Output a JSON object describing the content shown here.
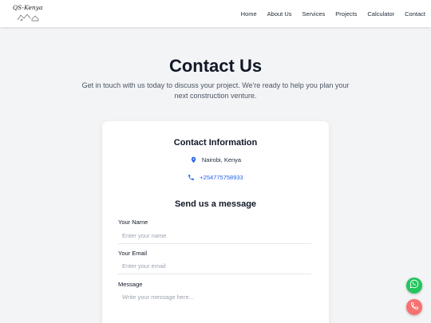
{
  "brand": {
    "logo_text": "QS-Kenya"
  },
  "nav": {
    "items": [
      "Home",
      "About Us",
      "Services",
      "Projects",
      "Calculator",
      "Contact"
    ]
  },
  "hero": {
    "title": "Contact Us",
    "subtitle": "Get in touch with us today to discuss your project. We're ready to help you plan your next construction venture."
  },
  "contact_info": {
    "heading": "Contact Information",
    "location": "Nairobi, Kenya",
    "phone": "+254775758933"
  },
  "form": {
    "heading": "Send us a message",
    "name_label": "Your Name",
    "name_placeholder": "Enter your name",
    "email_label": "Your Email",
    "email_placeholder": "Enter your email",
    "message_label": "Message",
    "message_placeholder": "Write your message here..."
  },
  "icons": {
    "location": "map-pin-icon",
    "phone": "phone-icon",
    "whatsapp": "whatsapp-icon",
    "call": "call-icon"
  },
  "colors": {
    "accent": "#2563eb",
    "whatsapp": "#22c55e",
    "call": "#f87171",
    "background": "#f3f4f6"
  }
}
